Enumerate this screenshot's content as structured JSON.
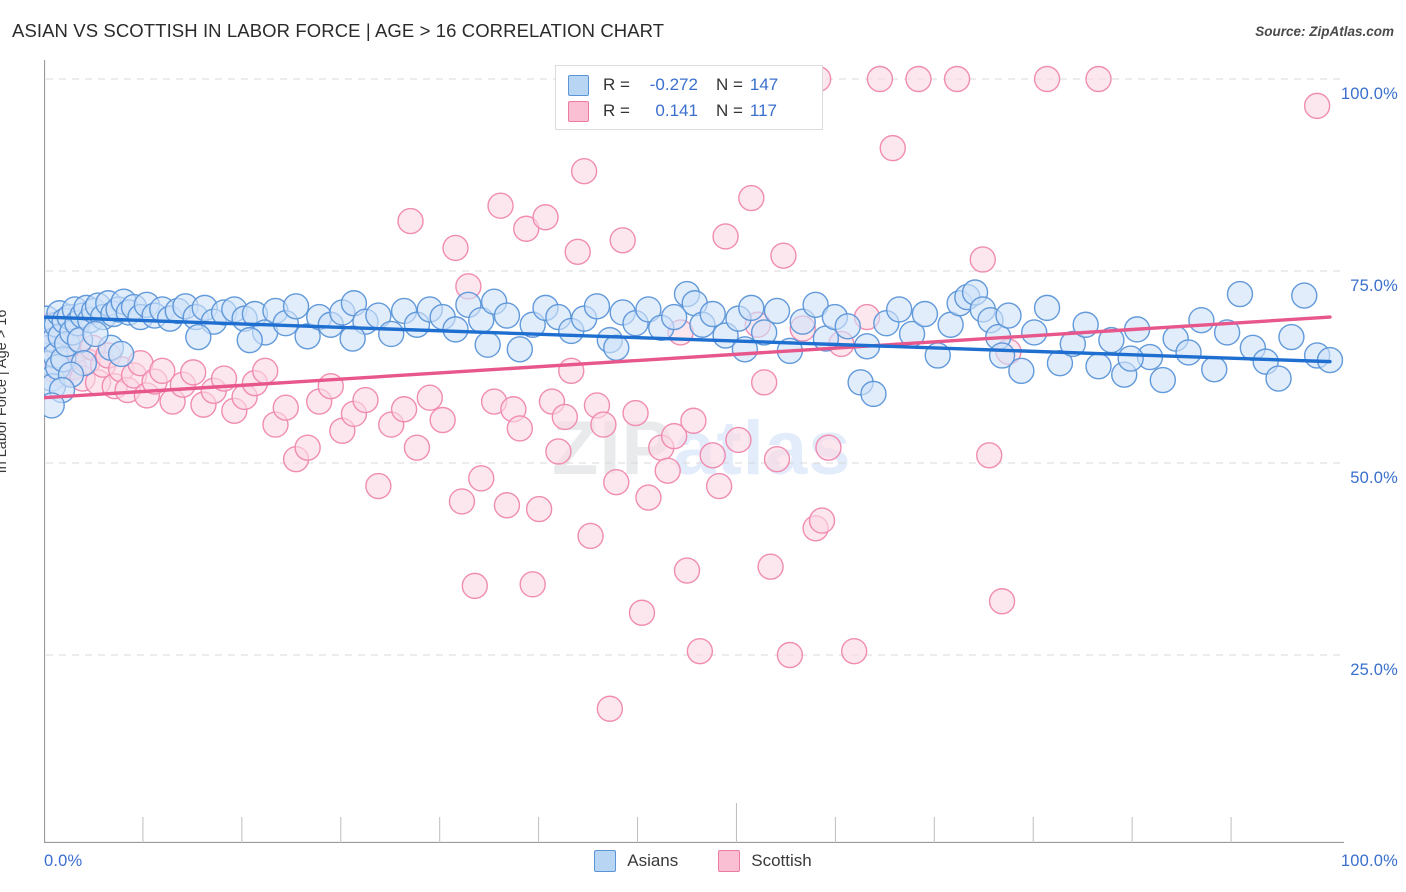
{
  "title": "ASIAN VS SCOTTISH IN LABOR FORCE | AGE > 16 CORRELATION CHART",
  "source": "Source: ZipAtlas.com",
  "watermark": {
    "part1": "ZIP",
    "part2": "atlas"
  },
  "colors": {
    "blue_fill": "#cfe2f8",
    "blue_stroke": "#5b95d8",
    "blue_line": "#1f6fd0",
    "pink_fill": "#fcd8e4",
    "pink_stroke": "#ef87ae",
    "pink_line": "#e8578b",
    "tick_label": "#3a6fce",
    "grid": "#d8d8d8"
  },
  "stats_legend": {
    "rows": [
      {
        "series": "Asians",
        "r_label": "R =",
        "r_value": "-0.272",
        "n_label": "N =",
        "n_value": "147"
      },
      {
        "series": "Scottish",
        "r_label": "R =",
        "r_value": "0.141",
        "n_label": "N =",
        "n_value": "117"
      }
    ]
  },
  "bottom_legend": {
    "items": [
      {
        "label": "Asians",
        "color": "#b9d5f4"
      },
      {
        "label": "Scottish",
        "color": "#fabfd3"
      }
    ]
  },
  "axes": {
    "y_title": "In Labor Force | Age > 16",
    "y_ticks": [
      "100.0%",
      "75.0%",
      "50.0%",
      "25.0%"
    ],
    "y_tick_values": [
      100,
      75,
      50,
      25
    ],
    "x_tick_left": "0.0%",
    "x_tick_right": "100.0%"
  },
  "chart_data": {
    "type": "scatter",
    "title": "ASIAN VS SCOTTISH IN LABOR FORCE | AGE > 16 CORRELATION CHART",
    "xlabel": "",
    "ylabel": "In Labor Force | Age > 16",
    "xlim": [
      0,
      100
    ],
    "ylim": [
      10,
      103
    ],
    "x_ticks": [
      0,
      100
    ],
    "y_ticks": [
      25,
      50,
      75,
      100
    ],
    "grid": "horizontal-dashed",
    "legend_position": "bottom-center",
    "series": [
      {
        "name": "Asians",
        "color": "#cfe2f8",
        "stroke": "#5b95d8",
        "r": -0.272,
        "n": 147,
        "trendline": {
          "x0": 0,
          "y0": 69.0,
          "x1": 100,
          "y1": 63.2,
          "color": "#1f6fd0"
        },
        "points": [
          [
            0.2,
            68.8
          ],
          [
            0.3,
            67.2
          ],
          [
            0.4,
            65.0
          ],
          [
            0.5,
            63.0
          ],
          [
            0.6,
            61.0
          ],
          [
            0.7,
            60.0
          ],
          [
            0.8,
            66.0
          ],
          [
            0.9,
            64.0
          ],
          [
            1.0,
            68.0
          ],
          [
            1.1,
            62.5
          ],
          [
            1.2,
            69.5
          ],
          [
            1.3,
            66.5
          ],
          [
            1.5,
            63.5
          ],
          [
            1.6,
            68.5
          ],
          [
            1.8,
            65.5
          ],
          [
            2.0,
            69.0
          ],
          [
            2.2,
            67.0
          ],
          [
            2.4,
            70.0
          ],
          [
            2.6,
            68.2
          ],
          [
            2.8,
            66.0
          ],
          [
            3.0,
            69.2
          ],
          [
            3.3,
            70.2
          ],
          [
            3.6,
            68.6
          ],
          [
            3.9,
            69.8
          ],
          [
            4.2,
            70.5
          ],
          [
            4.6,
            69.0
          ],
          [
            5.0,
            70.8
          ],
          [
            5.4,
            69.4
          ],
          [
            5.8,
            70.0
          ],
          [
            6.2,
            71.0
          ],
          [
            6.6,
            69.6
          ],
          [
            7.0,
            70.3
          ],
          [
            7.5,
            69.0
          ],
          [
            8.0,
            70.6
          ],
          [
            8.6,
            69.2
          ],
          [
            9.2,
            70.0
          ],
          [
            9.8,
            68.8
          ],
          [
            10.4,
            69.8
          ],
          [
            11.0,
            70.4
          ],
          [
            11.8,
            69.0
          ],
          [
            12.5,
            70.2
          ],
          [
            13.2,
            68.4
          ],
          [
            14.0,
            69.6
          ],
          [
            14.8,
            70.0
          ],
          [
            15.6,
            68.8
          ],
          [
            16.4,
            69.4
          ],
          [
            17.2,
            67.0
          ],
          [
            18.0,
            69.8
          ],
          [
            18.8,
            68.2
          ],
          [
            19.6,
            70.4
          ],
          [
            20.5,
            66.5
          ],
          [
            21.4,
            69.0
          ],
          [
            22.3,
            68.0
          ],
          [
            23.2,
            69.6
          ],
          [
            24.1,
            70.8
          ],
          [
            25.0,
            68.4
          ],
          [
            26.0,
            69.2
          ],
          [
            27.0,
            66.8
          ],
          [
            28.0,
            69.8
          ],
          [
            29.0,
            68.0
          ],
          [
            30.0,
            70.0
          ],
          [
            31.0,
            69.0
          ],
          [
            32.0,
            67.4
          ],
          [
            33.0,
            70.6
          ],
          [
            34.0,
            68.6
          ],
          [
            35.0,
            71.0
          ],
          [
            36.0,
            69.2
          ],
          [
            37.0,
            64.8
          ],
          [
            38.0,
            68.0
          ],
          [
            39.0,
            70.2
          ],
          [
            40.0,
            69.0
          ],
          [
            41.0,
            67.2
          ],
          [
            42.0,
            68.8
          ],
          [
            43.0,
            70.4
          ],
          [
            44.0,
            66.0
          ],
          [
            45.0,
            69.6
          ],
          [
            46.0,
            68.2
          ],
          [
            47.0,
            70.0
          ],
          [
            48.0,
            67.6
          ],
          [
            49.0,
            69.0
          ],
          [
            50.0,
            72.0
          ],
          [
            50.6,
            70.8
          ],
          [
            51.2,
            68.0
          ],
          [
            52.0,
            69.4
          ],
          [
            53.0,
            66.6
          ],
          [
            54.0,
            68.8
          ],
          [
            55.0,
            70.2
          ],
          [
            56.0,
            67.0
          ],
          [
            57.0,
            69.8
          ],
          [
            58.0,
            64.6
          ],
          [
            59.0,
            68.4
          ],
          [
            60.0,
            70.6
          ],
          [
            60.8,
            66.2
          ],
          [
            61.5,
            69.0
          ],
          [
            62.5,
            67.8
          ],
          [
            63.5,
            60.5
          ],
          [
            64.5,
            59.0
          ],
          [
            65.5,
            68.2
          ],
          [
            66.5,
            70.0
          ],
          [
            67.5,
            66.8
          ],
          [
            68.5,
            69.4
          ],
          [
            69.5,
            64.0
          ],
          [
            70.5,
            68.0
          ],
          [
            71.2,
            70.8
          ],
          [
            71.8,
            71.6
          ],
          [
            72.4,
            72.2
          ],
          [
            73.0,
            70.0
          ],
          [
            73.6,
            68.6
          ],
          [
            74.2,
            66.4
          ],
          [
            75.0,
            69.2
          ],
          [
            76.0,
            62.0
          ],
          [
            77.0,
            67.0
          ],
          [
            78.0,
            70.2
          ],
          [
            79.0,
            63.0
          ],
          [
            80.0,
            65.5
          ],
          [
            81.0,
            68.0
          ],
          [
            82.0,
            62.6
          ],
          [
            83.0,
            66.0
          ],
          [
            84.0,
            61.5
          ],
          [
            85.0,
            67.4
          ],
          [
            86.0,
            63.8
          ],
          [
            87.0,
            60.8
          ],
          [
            88.0,
            66.2
          ],
          [
            89.0,
            64.4
          ],
          [
            90.0,
            68.6
          ],
          [
            91.0,
            62.2
          ],
          [
            92.0,
            67.0
          ],
          [
            93.0,
            72.0
          ],
          [
            94.0,
            65.0
          ],
          [
            95.0,
            63.2
          ],
          [
            96.0,
            61.0
          ],
          [
            97.0,
            66.4
          ],
          [
            98.0,
            71.8
          ],
          [
            99.0,
            64.0
          ],
          [
            100.0,
            63.4
          ],
          [
            5.2,
            65.0
          ],
          [
            6.0,
            64.2
          ],
          [
            3.1,
            63.0
          ],
          [
            2.1,
            61.5
          ],
          [
            1.4,
            59.5
          ],
          [
            0.6,
            57.5
          ],
          [
            4.0,
            66.8
          ],
          [
            12.0,
            66.4
          ],
          [
            16.0,
            66.0
          ],
          [
            24.0,
            66.2
          ],
          [
            34.5,
            65.4
          ],
          [
            44.5,
            65.0
          ],
          [
            54.5,
            64.8
          ],
          [
            64.0,
            65.2
          ],
          [
            74.5,
            64.0
          ],
          [
            84.5,
            63.6
          ]
        ]
      },
      {
        "name": "Scottish",
        "color": "#fcd8e4",
        "stroke": "#ef87ae",
        "r": 0.141,
        "n": 117,
        "trendline": {
          "x0": 0,
          "y0": 58.5,
          "x1": 100,
          "y1": 69.0,
          "color": "#e8578b"
        },
        "points": [
          [
            0.2,
            66.5
          ],
          [
            0.3,
            65.0
          ],
          [
            0.4,
            67.5
          ],
          [
            0.5,
            64.0
          ],
          [
            0.6,
            68.0
          ],
          [
            0.7,
            63.0
          ],
          [
            0.8,
            66.0
          ],
          [
            0.9,
            62.0
          ],
          [
            1.0,
            67.0
          ],
          [
            1.2,
            64.5
          ],
          [
            1.4,
            61.5
          ],
          [
            1.6,
            65.5
          ],
          [
            1.8,
            63.5
          ],
          [
            2.0,
            66.2
          ],
          [
            2.3,
            62.5
          ],
          [
            2.6,
            64.8
          ],
          [
            3.0,
            61.0
          ],
          [
            3.4,
            63.2
          ],
          [
            3.8,
            65.0
          ],
          [
            4.2,
            60.5
          ],
          [
            4.6,
            62.8
          ],
          [
            5.0,
            64.0
          ],
          [
            5.5,
            60.0
          ],
          [
            6.0,
            62.2
          ],
          [
            6.5,
            59.5
          ],
          [
            7.0,
            61.4
          ],
          [
            7.5,
            63.0
          ],
          [
            8.0,
            58.8
          ],
          [
            8.6,
            60.6
          ],
          [
            9.2,
            62.0
          ],
          [
            10.0,
            58.0
          ],
          [
            10.8,
            60.2
          ],
          [
            11.6,
            61.8
          ],
          [
            12.4,
            57.6
          ],
          [
            13.2,
            59.4
          ],
          [
            14.0,
            61.0
          ],
          [
            14.8,
            56.8
          ],
          [
            15.6,
            58.6
          ],
          [
            16.4,
            60.4
          ],
          [
            17.2,
            62.0
          ],
          [
            18.0,
            55.0
          ],
          [
            18.8,
            57.2
          ],
          [
            19.6,
            50.5
          ],
          [
            20.5,
            52.0
          ],
          [
            21.4,
            58.0
          ],
          [
            22.3,
            60.0
          ],
          [
            23.2,
            54.2
          ],
          [
            24.1,
            56.4
          ],
          [
            25.0,
            58.2
          ],
          [
            26.0,
            47.0
          ],
          [
            27.0,
            55.0
          ],
          [
            28.0,
            57.0
          ],
          [
            28.5,
            81.5
          ],
          [
            29.0,
            52.0
          ],
          [
            30.0,
            58.5
          ],
          [
            31.0,
            55.6
          ],
          [
            32.0,
            78.0
          ],
          [
            32.5,
            45.0
          ],
          [
            33.0,
            73.0
          ],
          [
            33.5,
            34.0
          ],
          [
            34.0,
            48.0
          ],
          [
            35.0,
            58.0
          ],
          [
            35.5,
            83.5
          ],
          [
            36.0,
            44.5
          ],
          [
            36.5,
            57.0
          ],
          [
            37.0,
            54.5
          ],
          [
            37.5,
            80.5
          ],
          [
            38.0,
            34.2
          ],
          [
            38.5,
            44.0
          ],
          [
            39.0,
            82.0
          ],
          [
            39.5,
            58.0
          ],
          [
            40.0,
            51.5
          ],
          [
            40.5,
            56.0
          ],
          [
            41.0,
            62.0
          ],
          [
            41.5,
            77.5
          ],
          [
            42.0,
            88.0
          ],
          [
            42.5,
            40.5
          ],
          [
            43.0,
            57.5
          ],
          [
            43.5,
            55.0
          ],
          [
            44.0,
            18.0
          ],
          [
            44.5,
            47.5
          ],
          [
            45.0,
            79.0
          ],
          [
            46.0,
            56.5
          ],
          [
            46.5,
            30.5
          ],
          [
            47.0,
            45.5
          ],
          [
            48.0,
            52.0
          ],
          [
            48.5,
            49.0
          ],
          [
            49.0,
            53.5
          ],
          [
            49.5,
            67.0
          ],
          [
            50.0,
            36.0
          ],
          [
            50.5,
            55.5
          ],
          [
            51.0,
            25.5
          ],
          [
            52.0,
            51.0
          ],
          [
            52.5,
            47.0
          ],
          [
            53.0,
            79.5
          ],
          [
            54.0,
            53.0
          ],
          [
            55.0,
            84.5
          ],
          [
            55.5,
            68.0
          ],
          [
            56.0,
            60.5
          ],
          [
            56.5,
            36.5
          ],
          [
            57.0,
            50.5
          ],
          [
            57.5,
            77.0
          ],
          [
            58.0,
            25.0
          ],
          [
            59.0,
            67.5
          ],
          [
            60.0,
            41.5
          ],
          [
            60.5,
            42.5
          ],
          [
            61.0,
            52.0
          ],
          [
            62.0,
            65.5
          ],
          [
            63.0,
            25.5
          ],
          [
            64.0,
            69.0
          ],
          [
            65.0,
            100.0
          ],
          [
            66.0,
            91.0
          ],
          [
            68.0,
            100.0
          ],
          [
            71.0,
            100.0
          ],
          [
            73.0,
            76.5
          ],
          [
            73.5,
            51.0
          ],
          [
            74.5,
            32.0
          ],
          [
            78.0,
            100.0
          ],
          [
            82.0,
            100.0
          ],
          [
            75.0,
            64.5
          ],
          [
            99.0,
            96.5
          ],
          [
            60.2,
            100.0
          ]
        ]
      }
    ]
  }
}
